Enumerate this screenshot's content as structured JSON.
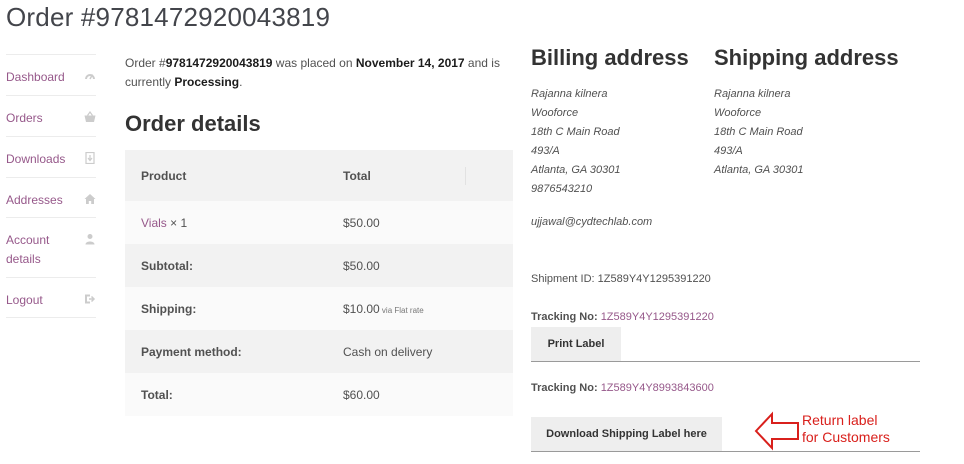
{
  "page": {
    "title": "Order #9781472920043819"
  },
  "sidebar": {
    "items": [
      {
        "label": "Dashboard",
        "icon": "dashboard-icon"
      },
      {
        "label": "Orders",
        "icon": "basket-icon"
      },
      {
        "label": "Downloads",
        "icon": "file-download-icon"
      },
      {
        "label": "Addresses",
        "icon": "home-icon"
      },
      {
        "label": "Account details",
        "icon": "user-icon"
      },
      {
        "label": "Logout",
        "icon": "logout-icon"
      }
    ]
  },
  "intro": {
    "prefix": "Order #",
    "order_number": "9781472920043819",
    "middle": " was placed on ",
    "date": "November 14, 2017",
    "suffix": " and is currently ",
    "status": "Processing",
    "end": "."
  },
  "order_details": {
    "heading": "Order details",
    "columns": [
      "Product",
      "Total"
    ],
    "item": {
      "product": "Vials",
      "qty": " × 1",
      "total": "$50.00"
    },
    "rows": [
      {
        "label": "Subtotal:",
        "value": "$50.00"
      },
      {
        "label": "Shipping:",
        "value": "$10.00",
        "note": " via Flat rate"
      },
      {
        "label": "Payment method:",
        "value": "Cash on delivery"
      },
      {
        "label": "Total:",
        "value": "$60.00"
      }
    ]
  },
  "billing": {
    "heading": "Billing address",
    "lines": [
      "Rajanna kilnera",
      "Wooforce",
      "18th C Main Road",
      "493/A",
      "Atlanta, GA 30301",
      "9876543210"
    ],
    "email": "ujjawal@cydtechlab.com"
  },
  "shipping": {
    "heading": "Shipping address",
    "lines": [
      "Rajanna kilnera",
      "Wooforce",
      "18th C Main Road",
      "493/A",
      "Atlanta, GA 30301"
    ]
  },
  "shipment": {
    "id_label": "Shipment ID: ",
    "id_value": "1Z589Y4Y1295391220",
    "tracking_label": "Tracking No: ",
    "tracking1": "1Z589Y4Y1295391220",
    "print_label": "Print Label",
    "tracking2": "1Z589Y4Y8993843600",
    "download_label": "Download Shipping Label here"
  },
  "annotation": {
    "line1": "Return label",
    "line2": "for Customers",
    "color": "#d9201c"
  }
}
